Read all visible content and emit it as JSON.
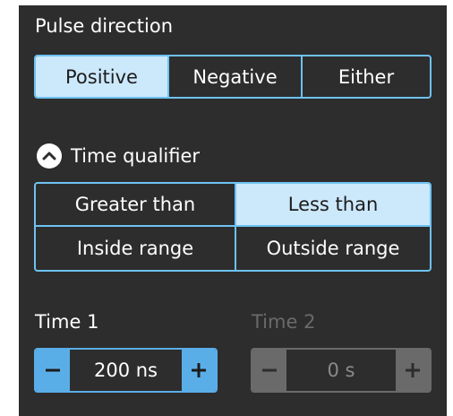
{
  "pulse_direction": {
    "title": "Pulse direction",
    "options": [
      "Positive",
      "Negative",
      "Either"
    ],
    "selected": "Positive"
  },
  "time_qualifier": {
    "title": "Time qualifier",
    "icon": "chevron-up-icon",
    "options": [
      "Greater than",
      "Less than",
      "Inside range",
      "Outside range"
    ],
    "selected": "Less than"
  },
  "time1": {
    "label": "Time 1",
    "value": "200 ns",
    "enabled": true
  },
  "time2": {
    "label": "Time 2",
    "value": "0 s",
    "enabled": false
  },
  "colors": {
    "panel": "#2d2d2d",
    "accent": "#6ec2f1",
    "selected_bg": "#cce8fb",
    "stepper_active": "#5aaee8",
    "stepper_disabled": "#6a6a6a"
  }
}
